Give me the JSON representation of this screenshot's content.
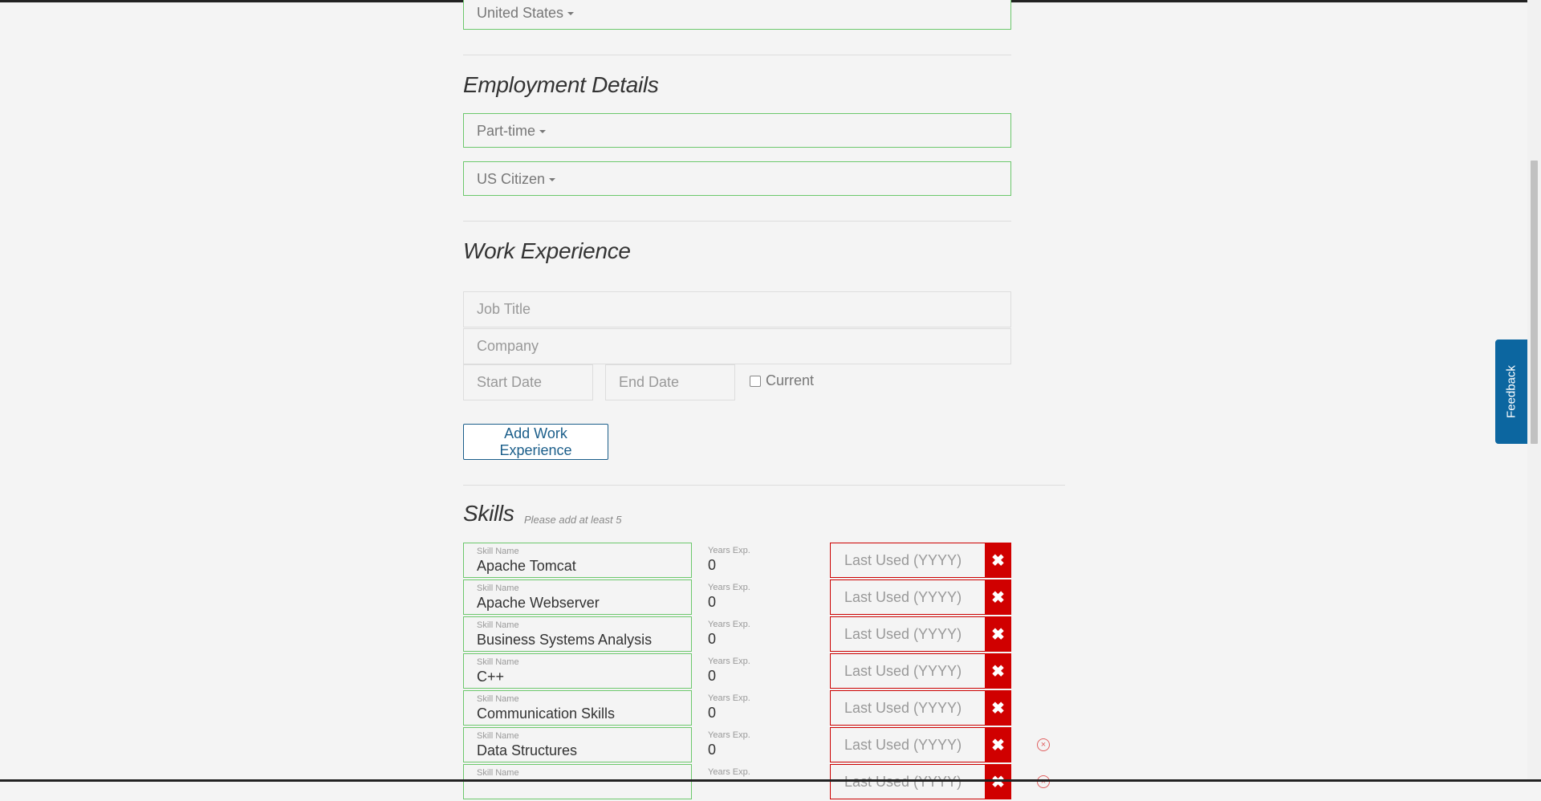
{
  "location": {
    "country": "United States"
  },
  "employment": {
    "title": "Employment Details",
    "type": "Part-time",
    "citizenship": "US Citizen"
  },
  "work_experience": {
    "title": "Work Experience",
    "job_title_placeholder": "Job Title",
    "company_placeholder": "Company",
    "start_date_placeholder": "Start Date",
    "end_date_placeholder": "End Date",
    "current_label": "Current",
    "add_button": "Add Work Experience"
  },
  "skills": {
    "title": "Skills",
    "hint": "Please add at least 5",
    "name_label": "Skill Name",
    "years_label": "Years Exp.",
    "last_used_placeholder": "Last Used (YYYY)",
    "remove_symbol": "✖",
    "items": [
      {
        "name": "Apache Tomcat",
        "years": "0"
      },
      {
        "name": "Apache Webserver",
        "years": "0"
      },
      {
        "name": "Business Systems Analysis",
        "years": "0"
      },
      {
        "name": "C++",
        "years": "0"
      },
      {
        "name": "Communication Skills",
        "years": "0"
      },
      {
        "name": "Data Structures",
        "years": "0"
      },
      {
        "name": "",
        "years": ""
      }
    ]
  },
  "feedback": {
    "label": "Feedback"
  }
}
